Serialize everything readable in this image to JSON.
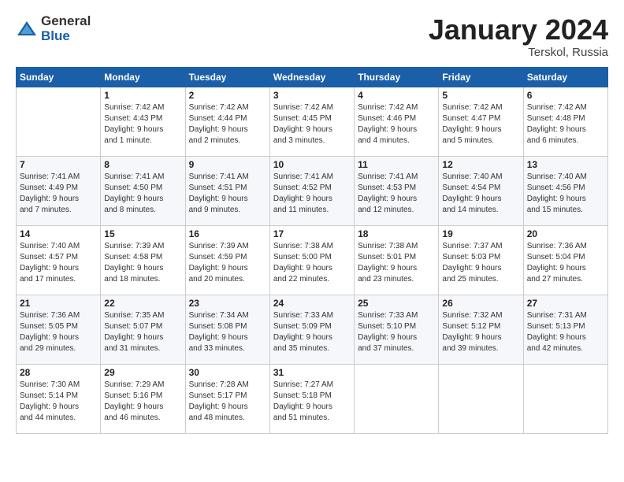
{
  "header": {
    "logo_general": "General",
    "logo_blue": "Blue",
    "month_title": "January 2024",
    "location": "Terskol, Russia"
  },
  "days_of_week": [
    "Sunday",
    "Monday",
    "Tuesday",
    "Wednesday",
    "Thursday",
    "Friday",
    "Saturday"
  ],
  "weeks": [
    [
      {
        "day": "",
        "info": ""
      },
      {
        "day": "1",
        "info": "Sunrise: 7:42 AM\nSunset: 4:43 PM\nDaylight: 9 hours\nand 1 minute."
      },
      {
        "day": "2",
        "info": "Sunrise: 7:42 AM\nSunset: 4:44 PM\nDaylight: 9 hours\nand 2 minutes."
      },
      {
        "day": "3",
        "info": "Sunrise: 7:42 AM\nSunset: 4:45 PM\nDaylight: 9 hours\nand 3 minutes."
      },
      {
        "day": "4",
        "info": "Sunrise: 7:42 AM\nSunset: 4:46 PM\nDaylight: 9 hours\nand 4 minutes."
      },
      {
        "day": "5",
        "info": "Sunrise: 7:42 AM\nSunset: 4:47 PM\nDaylight: 9 hours\nand 5 minutes."
      },
      {
        "day": "6",
        "info": "Sunrise: 7:42 AM\nSunset: 4:48 PM\nDaylight: 9 hours\nand 6 minutes."
      }
    ],
    [
      {
        "day": "7",
        "info": "Sunrise: 7:41 AM\nSunset: 4:49 PM\nDaylight: 9 hours\nand 7 minutes."
      },
      {
        "day": "8",
        "info": "Sunrise: 7:41 AM\nSunset: 4:50 PM\nDaylight: 9 hours\nand 8 minutes."
      },
      {
        "day": "9",
        "info": "Sunrise: 7:41 AM\nSunset: 4:51 PM\nDaylight: 9 hours\nand 9 minutes."
      },
      {
        "day": "10",
        "info": "Sunrise: 7:41 AM\nSunset: 4:52 PM\nDaylight: 9 hours\nand 11 minutes."
      },
      {
        "day": "11",
        "info": "Sunrise: 7:41 AM\nSunset: 4:53 PM\nDaylight: 9 hours\nand 12 minutes."
      },
      {
        "day": "12",
        "info": "Sunrise: 7:40 AM\nSunset: 4:54 PM\nDaylight: 9 hours\nand 14 minutes."
      },
      {
        "day": "13",
        "info": "Sunrise: 7:40 AM\nSunset: 4:56 PM\nDaylight: 9 hours\nand 15 minutes."
      }
    ],
    [
      {
        "day": "14",
        "info": "Sunrise: 7:40 AM\nSunset: 4:57 PM\nDaylight: 9 hours\nand 17 minutes."
      },
      {
        "day": "15",
        "info": "Sunrise: 7:39 AM\nSunset: 4:58 PM\nDaylight: 9 hours\nand 18 minutes."
      },
      {
        "day": "16",
        "info": "Sunrise: 7:39 AM\nSunset: 4:59 PM\nDaylight: 9 hours\nand 20 minutes."
      },
      {
        "day": "17",
        "info": "Sunrise: 7:38 AM\nSunset: 5:00 PM\nDaylight: 9 hours\nand 22 minutes."
      },
      {
        "day": "18",
        "info": "Sunrise: 7:38 AM\nSunset: 5:01 PM\nDaylight: 9 hours\nand 23 minutes."
      },
      {
        "day": "19",
        "info": "Sunrise: 7:37 AM\nSunset: 5:03 PM\nDaylight: 9 hours\nand 25 minutes."
      },
      {
        "day": "20",
        "info": "Sunrise: 7:36 AM\nSunset: 5:04 PM\nDaylight: 9 hours\nand 27 minutes."
      }
    ],
    [
      {
        "day": "21",
        "info": "Sunrise: 7:36 AM\nSunset: 5:05 PM\nDaylight: 9 hours\nand 29 minutes."
      },
      {
        "day": "22",
        "info": "Sunrise: 7:35 AM\nSunset: 5:07 PM\nDaylight: 9 hours\nand 31 minutes."
      },
      {
        "day": "23",
        "info": "Sunrise: 7:34 AM\nSunset: 5:08 PM\nDaylight: 9 hours\nand 33 minutes."
      },
      {
        "day": "24",
        "info": "Sunrise: 7:33 AM\nSunset: 5:09 PM\nDaylight: 9 hours\nand 35 minutes."
      },
      {
        "day": "25",
        "info": "Sunrise: 7:33 AM\nSunset: 5:10 PM\nDaylight: 9 hours\nand 37 minutes."
      },
      {
        "day": "26",
        "info": "Sunrise: 7:32 AM\nSunset: 5:12 PM\nDaylight: 9 hours\nand 39 minutes."
      },
      {
        "day": "27",
        "info": "Sunrise: 7:31 AM\nSunset: 5:13 PM\nDaylight: 9 hours\nand 42 minutes."
      }
    ],
    [
      {
        "day": "28",
        "info": "Sunrise: 7:30 AM\nSunset: 5:14 PM\nDaylight: 9 hours\nand 44 minutes."
      },
      {
        "day": "29",
        "info": "Sunrise: 7:29 AM\nSunset: 5:16 PM\nDaylight: 9 hours\nand 46 minutes."
      },
      {
        "day": "30",
        "info": "Sunrise: 7:28 AM\nSunset: 5:17 PM\nDaylight: 9 hours\nand 48 minutes."
      },
      {
        "day": "31",
        "info": "Sunrise: 7:27 AM\nSunset: 5:18 PM\nDaylight: 9 hours\nand 51 minutes."
      },
      {
        "day": "",
        "info": ""
      },
      {
        "day": "",
        "info": ""
      },
      {
        "day": "",
        "info": ""
      }
    ]
  ]
}
